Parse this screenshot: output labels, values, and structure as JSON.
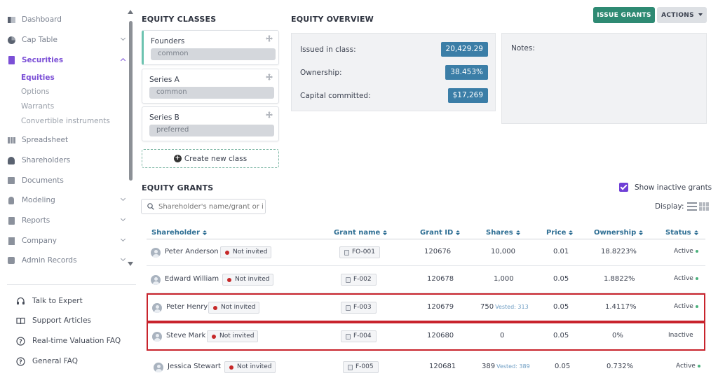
{
  "sidebar": {
    "nav": [
      {
        "label": "Dashboard",
        "icon": "dashboard-icon"
      },
      {
        "label": "Cap Table",
        "icon": "pie-chart-icon"
      },
      {
        "label": "Securities",
        "icon": "clipboard-icon"
      },
      {
        "label": "Spreadsheet",
        "icon": "spreadsheet-icon"
      },
      {
        "label": "Shareholders",
        "icon": "user-icon"
      },
      {
        "label": "Documents",
        "icon": "document-icon"
      },
      {
        "label": "Modeling",
        "icon": "lightbulb-icon"
      },
      {
        "label": "Reports",
        "icon": "report-icon"
      },
      {
        "label": "Company",
        "icon": "building-icon"
      },
      {
        "label": "Admin Records",
        "icon": "admin-icon"
      }
    ],
    "securities_sub": [
      "Equities",
      "Options",
      "Warrants",
      "Convertible instruments"
    ],
    "help": [
      {
        "label": "Talk to Expert",
        "icon": "headset-icon"
      },
      {
        "label": "Support Articles",
        "icon": "book-icon"
      },
      {
        "label": "Real-time Valuation FAQ",
        "icon": "question-circle-icon"
      },
      {
        "label": "General FAQ",
        "icon": "question-circle-icon"
      }
    ]
  },
  "equity_classes": {
    "title": "EQUITY CLASSES",
    "classes": [
      {
        "name": "Founders",
        "type": "common"
      },
      {
        "name": "Series A",
        "type": "common"
      },
      {
        "name": "Series B",
        "type": "preferred"
      }
    ],
    "create_label": "Create new class"
  },
  "overview": {
    "title": "EQUITY OVERVIEW",
    "issued_label": "Issued in class:",
    "issued_value": "20,429.29",
    "ownership_label": "Ownership:",
    "ownership_value": "38.453%",
    "capital_label": "Capital committed:",
    "capital_value": "$17,269",
    "notes_label": "Notes:"
  },
  "toolbar": {
    "issue_label": "ISSUE GRANTS",
    "actions_label": "ACTIONS"
  },
  "grants": {
    "title": "EQUITY GRANTS",
    "show_inactive_label": "Show inactive grants",
    "search_placeholder": "Shareholder's name/grant or id",
    "display_label": "Display:",
    "columns": [
      "Shareholder",
      "Grant name",
      "Grant ID",
      "Shares",
      "Price",
      "Ownership",
      "Status"
    ],
    "rows": [
      {
        "name": "Peter Anderson",
        "invite": "Not invited",
        "grant": "FO-001",
        "grant_id": "120676",
        "shares": "10,000",
        "vested": "",
        "price": "0.01",
        "ownership": "18.8223%",
        "status": "Active"
      },
      {
        "name": "Edward William",
        "invite": "Not invited",
        "grant": "F-002",
        "grant_id": "120678",
        "shares": "1,000",
        "vested": "",
        "price": "0.05",
        "ownership": "1.8822%",
        "status": "Active"
      },
      {
        "name": "Peter Henry",
        "invite": "Not invited",
        "grant": "F-003",
        "grant_id": "120679",
        "shares": "750",
        "vested": "Vested: 313",
        "price": "0.05",
        "ownership": "1.4117%",
        "status": "Active"
      },
      {
        "name": "Steve Mark",
        "invite": "Not invited",
        "grant": "F-004",
        "grant_id": "120680",
        "shares": "0",
        "vested": "",
        "price": "0.05",
        "ownership": "0%",
        "status": "Inactive"
      },
      {
        "name": "Jessica Stewart",
        "invite": "Not invited",
        "grant": "F-005",
        "grant_id": "120681",
        "shares": "389",
        "vested": "Vested: 389",
        "price": "0.05",
        "ownership": "0.732%",
        "status": "Active"
      }
    ]
  },
  "colors": {
    "accent_purple": "#7b4fd6",
    "issue_green": "#2e8a73",
    "value_blue": "#3b7ea7",
    "highlight_red": "#c8232c",
    "status_active": "#4bb07c",
    "not_invited_dot": "#c62828"
  }
}
